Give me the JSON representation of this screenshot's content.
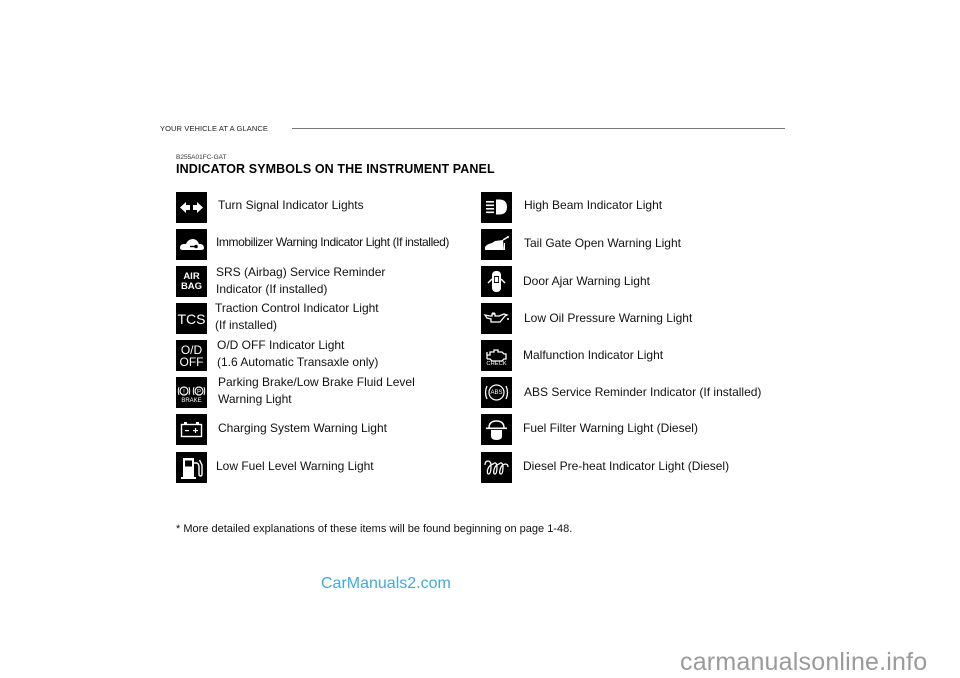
{
  "running_head": "YOUR VEHICLE AT A GLANCE",
  "section_code": "B255A01FC-GAT",
  "title": "INDICATOR SYMBOLS ON THE INSTRUMENT PANEL",
  "left_column": [
    {
      "icon": "turn-signal-icon",
      "lines": [
        "Turn Signal Indicator Lights"
      ]
    },
    {
      "icon": "immobilizer-icon",
      "lines": [
        "Immobilizer Warning Indicator Light (If installed)"
      ]
    },
    {
      "icon": "airbag-icon",
      "icon_text": [
        "AIR",
        "BAG"
      ],
      "lines": [
        "SRS (Airbag) Service Reminder",
        "Indicator (If installed)"
      ]
    },
    {
      "icon": "tcs-icon",
      "icon_text": [
        "TCS"
      ],
      "lines": [
        "Traction Control Indicator Light",
        "(If installed)"
      ]
    },
    {
      "icon": "od-off-icon",
      "icon_text": [
        "O/D",
        "OFF"
      ],
      "lines": [
        "O/D OFF Indicator Light",
        "(1.6 Automatic Transaxle only)"
      ]
    },
    {
      "icon": "brake-icon",
      "icon_text": [
        "BRAKE"
      ],
      "lines": [
        "Parking Brake/Low Brake Fluid Level",
        "Warning Light"
      ]
    },
    {
      "icon": "battery-icon",
      "lines": [
        "Charging System Warning Light"
      ]
    },
    {
      "icon": "fuel-pump-icon",
      "lines": [
        "Low Fuel Level Warning Light"
      ]
    }
  ],
  "right_column": [
    {
      "icon": "high-beam-icon",
      "lines": [
        "High Beam Indicator Light"
      ]
    },
    {
      "icon": "tail-gate-icon",
      "lines": [
        "Tail Gate Open Warning Light"
      ]
    },
    {
      "icon": "door-ajar-icon",
      "lines": [
        "Door Ajar Warning Light"
      ]
    },
    {
      "icon": "oil-can-icon",
      "lines": [
        "Low Oil Pressure Warning Light"
      ]
    },
    {
      "icon": "check-engine-icon",
      "icon_text": [
        "CHECK"
      ],
      "lines": [
        "Malfunction Indicator Light"
      ]
    },
    {
      "icon": "abs-icon",
      "icon_text": [
        "ABS"
      ],
      "lines": [
        "ABS Service Reminder Indicator (If installed)"
      ]
    },
    {
      "icon": "fuel-filter-icon",
      "lines": [
        "Fuel Filter Warning Light (Diesel)"
      ]
    },
    {
      "icon": "glow-plug-icon",
      "lines": [
        "Diesel Pre-heat Indicator Light (Diesel)"
      ]
    }
  ],
  "footnote": "* More detailed explanations of these items will be found beginning on page 1-48.",
  "watermarks": {
    "carmanuals2": "CarManuals2.com",
    "carmanualsonline": "carmanualsonline.info"
  },
  "colors": {
    "watermark_blue": "#3fa9e0",
    "watermark_gray": "#9a9a9a",
    "icon_bg": "#000000"
  }
}
